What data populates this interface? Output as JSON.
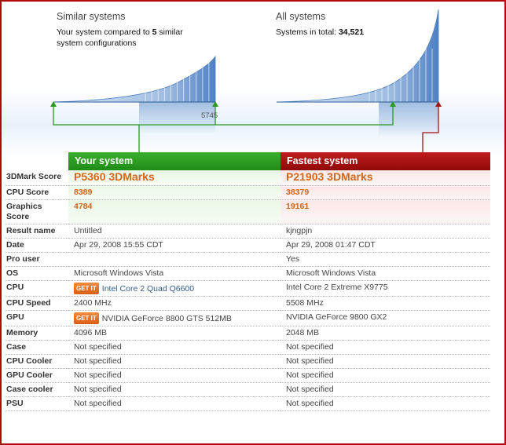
{
  "similar": {
    "title": "Similar systems",
    "text_prefix": "Your system compared to ",
    "count": "5",
    "text_suffix": " similar system configurations",
    "marker_score": "5745"
  },
  "all": {
    "title": "All systems",
    "text_prefix": "Systems in total: ",
    "total": "34,521"
  },
  "headers": {
    "yours": "Your system",
    "fastest": "Fastest system"
  },
  "rows": [
    {
      "label": "3DMark Score",
      "yours": "P5360 3DMarks",
      "fastest": "P21903 3DMarks",
      "style": "big"
    },
    {
      "label": "CPU Score",
      "yours": "8389",
      "fastest": "38379",
      "style": "orange"
    },
    {
      "label": "Graphics Score",
      "yours": "4784",
      "fastest": "19161",
      "style": "orange"
    },
    {
      "label": "Result name",
      "yours": "Untitled",
      "fastest": "kjngpjn"
    },
    {
      "label": "Date",
      "yours": "Apr 29, 2008 15:55 CDT",
      "fastest": "Apr 29, 2008 01:47 CDT"
    },
    {
      "label": "Pro user",
      "yours": "",
      "fastest": "Yes"
    },
    {
      "label": "OS",
      "yours": "Microsoft Windows Vista",
      "fastest": "Microsoft Windows Vista"
    },
    {
      "label": "CPU",
      "yours": "Intel Core 2 Quad Q6600",
      "fastest": "Intel Core 2 Extreme X9775",
      "getit": true,
      "link": true
    },
    {
      "label": "CPU Speed",
      "yours": "2400 MHz",
      "fastest": "5508 MHz"
    },
    {
      "label": "GPU",
      "yours": "NVIDIA GeForce 8800 GTS 512MB",
      "fastest": "NVIDIA GeForce 9800 GX2",
      "getit": true
    },
    {
      "label": "Memory",
      "yours": "4096 MB",
      "fastest": "2048 MB"
    },
    {
      "label": "Case",
      "yours": "Not specified",
      "fastest": "Not specified"
    },
    {
      "label": "CPU Cooler",
      "yours": "Not specified",
      "fastest": "Not specified"
    },
    {
      "label": "GPU Cooler",
      "yours": "Not specified",
      "fastest": "Not specified"
    },
    {
      "label": "Case cooler",
      "yours": "Not specified",
      "fastest": "Not specified"
    },
    {
      "label": "PSU",
      "yours": "Not specified",
      "fastest": "Not specified"
    }
  ],
  "getit_label": "GET IT",
  "colors": {
    "accent_green": "#1f8c16",
    "accent_red": "#8f0a0a",
    "score_orange": "#d2661a",
    "curve_blue": "#4a7fc1"
  }
}
